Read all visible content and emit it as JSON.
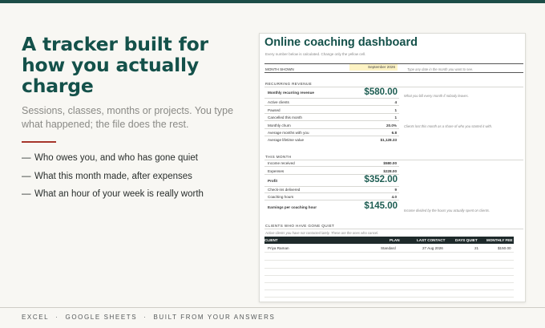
{
  "hero": {
    "title": "A tracker built for how you actually charge",
    "subtitle": "Sessions, classes, months or projects. You type what happened; the file does the rest.",
    "bullets": [
      "Who owes you, and who has gone quiet",
      "What this month made, after expenses",
      "What an hour of your week is really worth"
    ],
    "bullet_marker": "—"
  },
  "footer": {
    "items": [
      "EXCEL",
      "GOOGLE SHEETS",
      "BUILT FROM YOUR ANSWERS"
    ],
    "separator": "·"
  },
  "sheet": {
    "title": "Online coaching dashboard",
    "subtitle": "Every number below is calculated. Change only the yellow cell.",
    "month_label": "MONTH SHOWN",
    "month_value": "September 2026",
    "month_note": "Type any date in the month you want to see.",
    "recurring": {
      "heading": "RECURRING REVENUE",
      "mrr_label": "Monthly recurring revenue",
      "mrr_value": "$580.00",
      "mrr_note": "What you bill every month if nobody leaves.",
      "rows": [
        {
          "label": "Active clients",
          "value": "4"
        },
        {
          "label": "Paused",
          "value": "1"
        },
        {
          "label": "Cancelled this month",
          "value": "1"
        },
        {
          "label": "Monthly churn",
          "value": "20.0%"
        },
        {
          "label": "Average months with you",
          "value": "6.8"
        },
        {
          "label": "Average lifetime value",
          "value": "$1,128.33"
        }
      ],
      "churn_note": "Clients lost this month as a share of who you started it with."
    },
    "this_month": {
      "heading": "THIS MONTH",
      "income_label": "Income received",
      "income_value": "$580.00",
      "expenses_label": "Expenses",
      "expenses_value": "$228.00",
      "profit_label": "Profit",
      "profit_value": "$352.00",
      "checkins_label": "Check-ins delivered",
      "checkins_value": "9",
      "hours_label": "Coaching hours",
      "hours_value": "4.0",
      "eph_label": "Earnings per coaching hour",
      "eph_value": "$145.00",
      "eph_note": "Income divided by the hours you actually spent on clients."
    },
    "quiet": {
      "heading": "CLIENTS WHO HAVE GONE QUIET",
      "note": "Active clients you have not contacted lately. These are the ones who cancel.",
      "columns": [
        "CLIENT",
        "PLAN",
        "LAST CONTACT",
        "DAYS QUIET",
        "MONTHLY FEE"
      ],
      "rows": [
        {
          "client": "Priya Raman",
          "plan": "Standard",
          "last_contact": "27 Aug 2026",
          "days_quiet": "21",
          "fee": "$150.00"
        }
      ]
    }
  }
}
